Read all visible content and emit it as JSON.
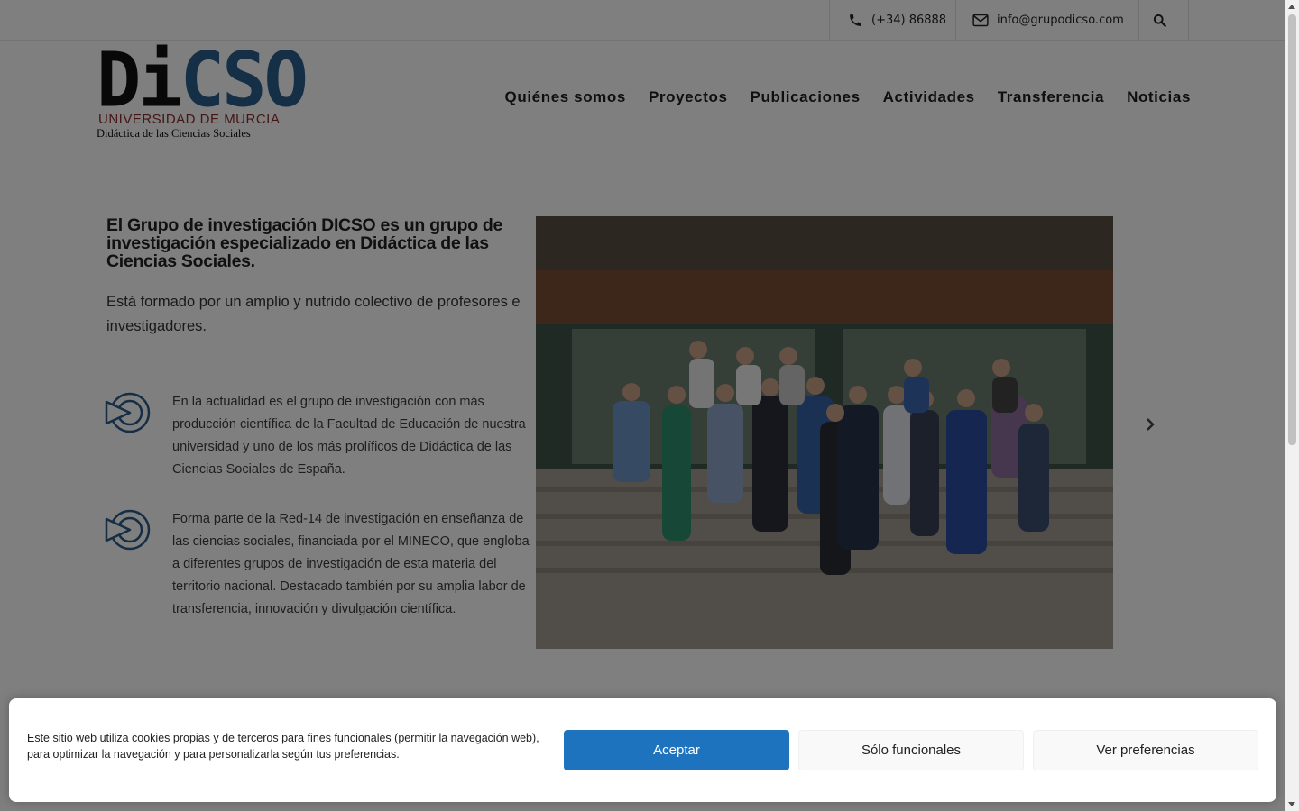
{
  "topbar": {
    "phone": "(+34) 86888",
    "email": "info@grupodicso.com"
  },
  "logo": {
    "letters_dark": "Di",
    "letters_blue": "CSO",
    "university": "UNIVERSIDAD DE MURCIA",
    "department": "Didáctica de las Ciencias Sociales"
  },
  "nav": {
    "items": [
      {
        "label": "Quiénes somos"
      },
      {
        "label": "Proyectos"
      },
      {
        "label": "Publicaciones"
      },
      {
        "label": "Actividades"
      },
      {
        "label": "Transferencia"
      },
      {
        "label": "Noticias"
      }
    ]
  },
  "intro": {
    "heading": "El Grupo de investigación DICSO es un grupo de investigación especializado en Didáctica de las Ciencias Sociales.",
    "text": "Está formado por un amplio y nutrido colectivo de profesores e investigadores."
  },
  "features": [
    {
      "text": "En la actualidad es el grupo de investigación con más producción científica de la Facultad de Educación de nuestra universidad y uno de los más prolíficos de Didáctica de las Ciencias Sociales de España."
    },
    {
      "text": "Forma parte de la Red-14 de investigación en enseñanza de las ciencias sociales, financiada por el MINECO, que engloba a diferentes grupos de investigación de esta materia del territorio nacional. Destacado también por su amplia labor de transferencia, innovación y divulgación científica."
    }
  ],
  "cookie": {
    "message": "Este sitio web utiliza cookies propias y de terceros para fines funcionales (permitir la navegación web), para optimizar la navegación y para personalizarla según tus preferencias.",
    "accept": "Aceptar",
    "functional": "Sólo funcionales",
    "preferences": "Ver preferencias"
  },
  "colors": {
    "accent": "#1e73be",
    "logo_blue": "#2b5f8e",
    "logo_red": "#8d2a2a",
    "icon_blue": "#2a5d8a"
  }
}
